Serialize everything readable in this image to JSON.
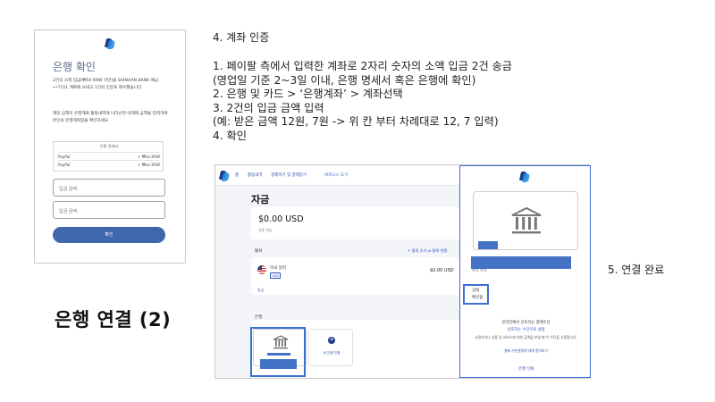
{
  "confirm_panel": {
    "title": "은행 확인",
    "desc1": "2건의 소액 입금(₩50 KRW 미만)을 SHINHAN BANK 예금 ••7151 계좌에 보내고 1건의 인증로 회수했습니다.",
    "desc2": "해당 금액이 은행계좌 활동내역에 나타난면 아래에 금액을 입력하여 본인의 은행계좌임을 확인하세요.",
    "statement_header": "은행 명세서",
    "statement_rows": [
      {
        "label": "PayPal",
        "value": "+ ₩xx KRW"
      },
      {
        "label": "PayPal",
        "value": "+ ₩xx KRW"
      }
    ],
    "amount_placeholder_1": "입금 금액",
    "amount_placeholder_2": "입금 금액",
    "confirm_button": "확인"
  },
  "left_caption": "은행 연결 (2)",
  "instructions": {
    "heading": "4. 계좌 인증",
    "lines": [
      "1.   페이팔 측에서 입력한 계좌로 2자리 숫자의 소액 입금 2건 송금",
      "(영업일 기준 2~3일 이내, 은행 명세서 혹은 은행에 확인)",
      "2. 은행 및 카드 > ‘은행계좌’ > 계좌선택",
      "3. 2건의 입금 금액 입력",
      "(예: 받은 금액 12원, 7원 -> 위 칸 부터 차례대로 12, 7 입력)",
      "4. 확인"
    ]
  },
  "done_caption": "5. 연결 완료",
  "wallet": {
    "nav": [
      "홈",
      "활동내역",
      "결제하기 및 결제받기",
      "비즈니스 도구"
    ],
    "section_title": "자금",
    "balance": "$0.00 USD",
    "balance_sub": "사용 가능",
    "currency_label": "통화",
    "currency_actions": "+ 통화 추가   ⇄ 통화 변환",
    "currency_name": "미국 달러",
    "currency_code": "USD",
    "currency_amount": "$0.00 USD",
    "currency_link": "송금",
    "bank_label": "은행",
    "add_bank_label": "새 은행 연결",
    "plus": "+"
  },
  "detail_panel": {
    "bank_link_label": "빌링 설정",
    "status_label": "상태",
    "status_value": "확인됨",
    "pref_title": "온라인에서 선호하는 결제수단",
    "pref_link": "선호하는 수단으로 설정",
    "pref_desc": "쇼핑하거나 상품 및 서비스에 대한 금액을 보낼 때 이 수단을 사용합니다.",
    "pref_more": "결제 기본설정에 대해 알아보기",
    "bank_delete": "은행 삭제"
  }
}
